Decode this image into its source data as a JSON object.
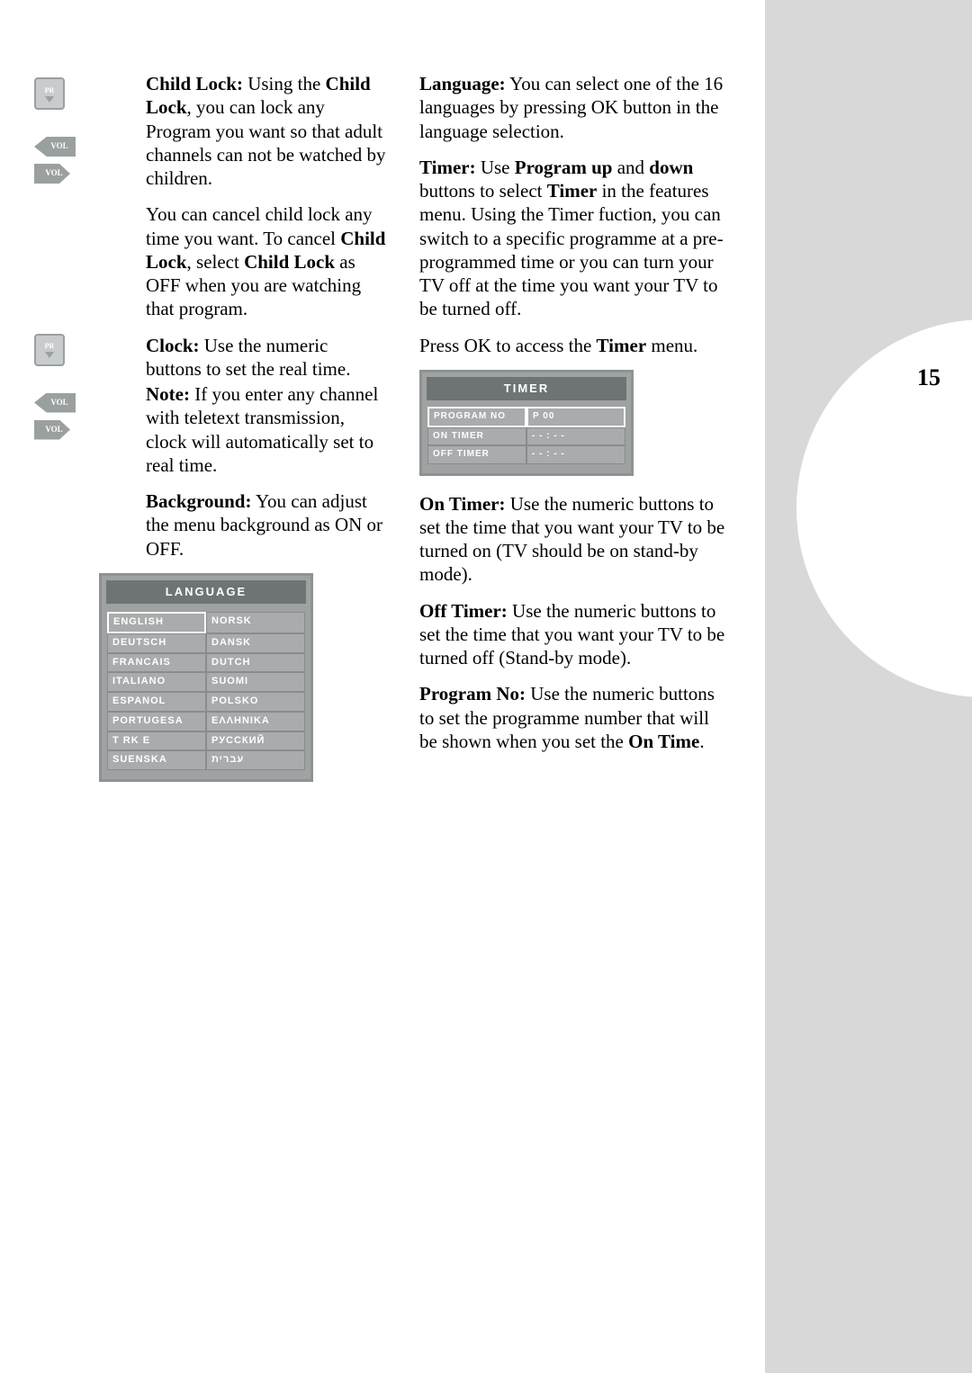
{
  "page_number": "15",
  "left": {
    "child_lock_label": "Child Lock:",
    "child_lock_text_1a": " Using the ",
    "child_lock_bold": "Child Lock",
    "child_lock_text_1b": ", you can lock any Program you want so that adult channels can not be watched by children.",
    "child_lock_text_2a": "You can cancel child lock any time you want. To cancel ",
    "child_lock_bold2": "Child Lock",
    "child_lock_text_2b": ", select ",
    "child_lock_bold3": "Child Lock",
    "child_lock_text_2c": " as OFF when you are watching that program.",
    "clock_label": "Clock:",
    "clock_text": " Use the numeric buttons to set the real time.",
    "note_label": "Note:",
    "note_text": " If you enter any channel with teletext transmission, clock will automatically set to real time.",
    "background_label": "Background:",
    "background_text": " You can adjust the menu background as ON or OFF."
  },
  "remote": {
    "pr": "PR",
    "vol": "VOL"
  },
  "language_menu": {
    "title": "LANGUAGE",
    "items_left": [
      "ENGLISH",
      "DEUTSCH",
      "FRANCAIS",
      "ITALIANO",
      "ESPANOL",
      "PORTUGESA",
      "T RK E",
      "SUENSKA"
    ],
    "items_right": [
      "NORSK",
      "DANSK",
      "DUTCH",
      "SUOMI",
      "POLSKO",
      "ΕΛΛΗΝΙΚΑ",
      "РУССКИЙ",
      "עברית"
    ]
  },
  "right": {
    "language_label": "Language:",
    "language_text": " You can select one of the 16 languages by pressing OK button in the language selection.",
    "timer_label": "Timer:",
    "timer_text_a": " Use ",
    "timer_bold_a": "Program up",
    "timer_text_b": " and ",
    "timer_bold_b": "down",
    "timer_text_c": " buttons to select ",
    "timer_bold_c": "Timer",
    "timer_text_d": " in the features menu. Using the Timer fuction, you can switch to a specific programme at a pre-programmed time or you can turn your TV off at the time you want your TV to be turned off.",
    "press_ok_a": "Press OK to access the ",
    "press_ok_bold": "Timer",
    "press_ok_b": " menu.",
    "on_timer_label": "On Timer:",
    "on_timer_text": " Use the numeric buttons to set the time that you want your TV to be turned on (TV should be on stand-by mode).",
    "off_timer_label": "Off Timer:",
    "off_timer_text": " Use the numeric buttons to set the time that you want your TV to be turned off (Stand-by mode).",
    "program_no_label": "Program No:",
    "program_no_text_a": " Use the numeric buttons to set the programme number that will be shown when you set the ",
    "program_no_bold": "On Time",
    "program_no_text_b": "."
  },
  "timer_menu": {
    "title": "TIMER",
    "rows": [
      {
        "label": "PROGRAM NO",
        "value": "P 00"
      },
      {
        "label": "ON TIMER",
        "value": "- - : - -"
      },
      {
        "label": "OFF TIMER",
        "value": "- - : - -"
      }
    ]
  }
}
